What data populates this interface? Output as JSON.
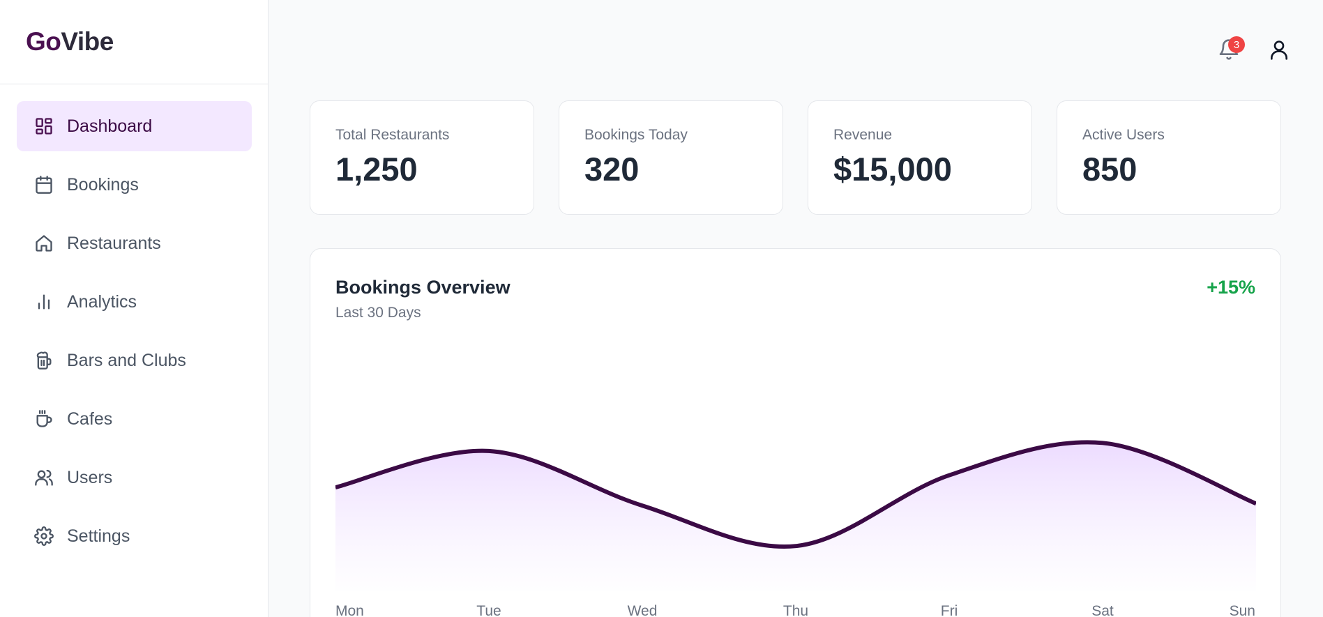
{
  "brand": {
    "logo_prefix": "Go",
    "logo_suffix": "Vibe"
  },
  "sidebar": {
    "items": [
      {
        "label": "Dashboard",
        "icon": "dashboard-icon",
        "active": true
      },
      {
        "label": "Bookings",
        "icon": "calendar-icon",
        "active": false
      },
      {
        "label": "Restaurants",
        "icon": "home-icon",
        "active": false
      },
      {
        "label": "Analytics",
        "icon": "bar-chart-icon",
        "active": false
      },
      {
        "label": "Bars and Clubs",
        "icon": "beer-mug-icon",
        "active": false
      },
      {
        "label": "Cafes",
        "icon": "coffee-cup-icon",
        "active": false
      },
      {
        "label": "Users",
        "icon": "users-icon",
        "active": false
      },
      {
        "label": "Settings",
        "icon": "gear-icon",
        "active": false
      }
    ]
  },
  "header": {
    "notifications": {
      "count": "3",
      "icon": "bell-icon"
    },
    "profile": {
      "icon": "user-icon"
    }
  },
  "stats": [
    {
      "label": "Total Restaurants",
      "value": "1,250"
    },
    {
      "label": "Bookings Today",
      "value": "320"
    },
    {
      "label": "Revenue",
      "value": "$15,000"
    },
    {
      "label": "Active Users",
      "value": "850"
    }
  ],
  "overview": {
    "title": "Bookings Overview",
    "subtitle": "Last 30 Days",
    "delta": "+15%",
    "delta_color": "#16a34a",
    "line_color": "#3b0a45",
    "fill_color": "#e9d5ff"
  },
  "chart_data": {
    "type": "area",
    "categories": [
      "Mon",
      "Tue",
      "Wed",
      "Thu",
      "Fri",
      "Sat",
      "Sun"
    ],
    "series": [
      {
        "values": [
          0.51,
          0.69,
          0.42,
          0.22,
          0.57,
          0.73,
          0.43
        ]
      }
    ],
    "grid": false,
    "legend": "none"
  }
}
